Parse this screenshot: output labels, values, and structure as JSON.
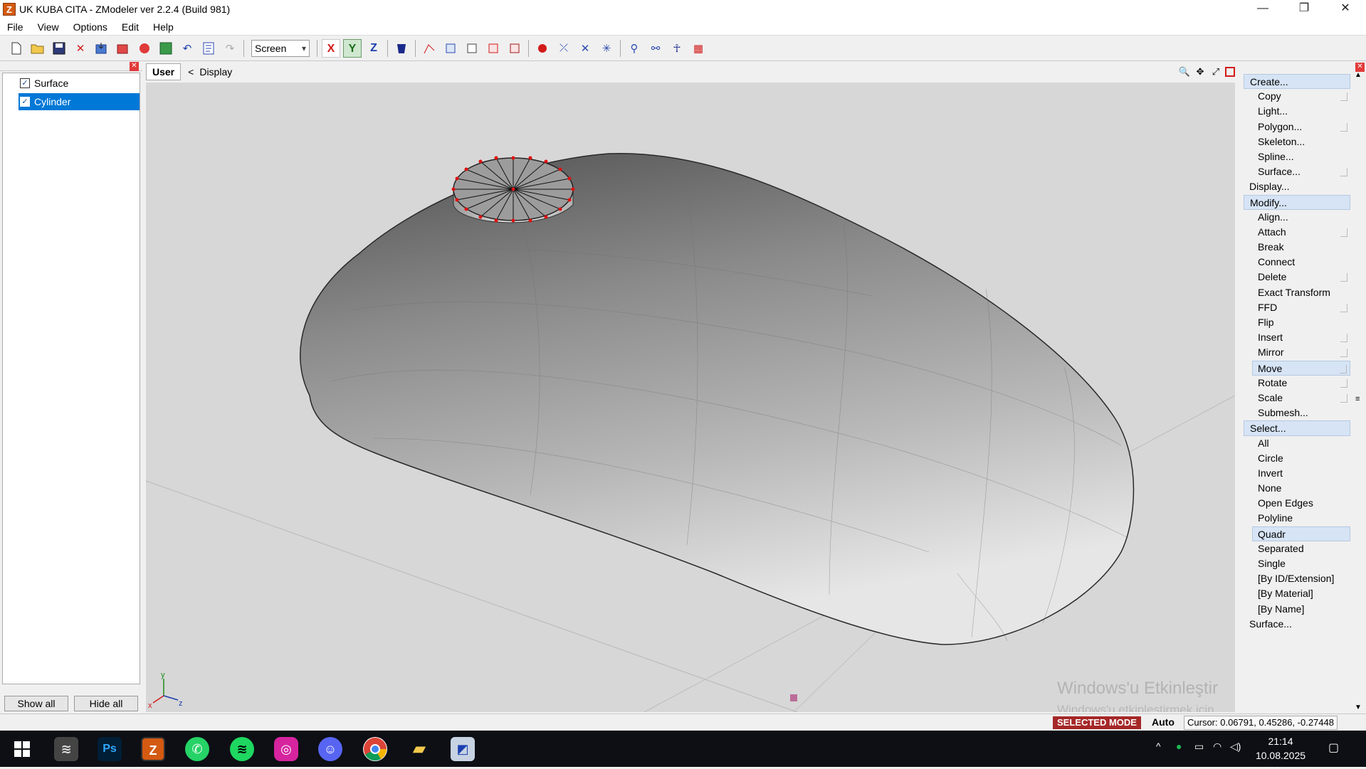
{
  "window": {
    "title": "UK KUBA CITA - ZModeler ver 2.2.4 (Build 981)",
    "app_icon_letter": "Z",
    "controls": [
      "—",
      "❐",
      "✕"
    ]
  },
  "menu": [
    "File",
    "View",
    "Options",
    "Edit",
    "Help"
  ],
  "toolbar": {
    "coord_system": "Screen",
    "axes": [
      "X",
      "Y",
      "Z"
    ]
  },
  "left_panel": {
    "items": [
      {
        "label": "Surface",
        "checked": true,
        "selected": false
      },
      {
        "label": "Cylinder",
        "checked": true,
        "selected": true
      }
    ],
    "show_all": "Show all",
    "hide_all": "Hide all"
  },
  "viewport": {
    "view_tab": "User",
    "display_label": "Display",
    "back_arrow": "<",
    "axis_labels": {
      "x": "x",
      "y": "y",
      "z": "z"
    },
    "watermark_title": "Windows'u Etkinleştir",
    "watermark_sub": "Windows'u etkinleştirmek için Ayarlar'a gidin."
  },
  "right_panel": {
    "items": [
      {
        "label": "Create...",
        "kind": "cat"
      },
      {
        "label": "Copy",
        "kind": "sub",
        "opt": true
      },
      {
        "label": "Light...",
        "kind": "sub"
      },
      {
        "label": "Polygon...",
        "kind": "sub",
        "opt": true
      },
      {
        "label": "Skeleton...",
        "kind": "sub"
      },
      {
        "label": "Spline...",
        "kind": "sub"
      },
      {
        "label": "Surface...",
        "kind": "sub",
        "opt": true
      },
      {
        "label": "Display...",
        "kind": "top"
      },
      {
        "label": "Modify...",
        "kind": "cat"
      },
      {
        "label": "Align...",
        "kind": "sub"
      },
      {
        "label": "Attach",
        "kind": "sub",
        "opt": true
      },
      {
        "label": "Break",
        "kind": "sub"
      },
      {
        "label": "Connect",
        "kind": "sub"
      },
      {
        "label": "Delete",
        "kind": "sub",
        "opt": true
      },
      {
        "label": "Exact Transform",
        "kind": "sub"
      },
      {
        "label": "FFD",
        "kind": "sub",
        "opt": true
      },
      {
        "label": "Flip",
        "kind": "sub"
      },
      {
        "label": "Insert",
        "kind": "sub",
        "opt": true
      },
      {
        "label": "Mirror",
        "kind": "sub",
        "opt": true
      },
      {
        "label": "Move",
        "kind": "hl",
        "opt": true
      },
      {
        "label": "Rotate",
        "kind": "sub",
        "opt": true
      },
      {
        "label": "Scale",
        "kind": "sub",
        "opt": true
      },
      {
        "label": "Submesh...",
        "kind": "sub"
      },
      {
        "label": "Select...",
        "kind": "cat"
      },
      {
        "label": "All",
        "kind": "sub"
      },
      {
        "label": "Circle",
        "kind": "sub"
      },
      {
        "label": "Invert",
        "kind": "sub"
      },
      {
        "label": "None",
        "kind": "sub"
      },
      {
        "label": "Open Edges",
        "kind": "sub"
      },
      {
        "label": "Polyline",
        "kind": "sub"
      },
      {
        "label": "Quadr",
        "kind": "hl"
      },
      {
        "label": "Separated",
        "kind": "sub"
      },
      {
        "label": "Single",
        "kind": "sub"
      },
      {
        "label": "[By ID/Extension]",
        "kind": "sub"
      },
      {
        "label": "[By Material]",
        "kind": "sub"
      },
      {
        "label": "[By Name]",
        "kind": "sub"
      },
      {
        "label": "Surface...",
        "kind": "top"
      }
    ]
  },
  "status": {
    "mode": "SELECTED MODE",
    "auto": "Auto",
    "cursor": "Cursor: 0.06791, 0.45286, -0.27448"
  },
  "taskbar": {
    "time": "21:14",
    "date": "10.08.2025",
    "apps": [
      "start-icon",
      "app-icon",
      "photoshop-icon",
      "zmodeler-icon",
      "whatsapp-icon",
      "spotify-icon",
      "instagram-icon",
      "discord-icon",
      "chrome-icon",
      "file-explorer-icon",
      "zmodeler2-icon"
    ],
    "ps_label": "Ps",
    "zm_label": "Z"
  }
}
